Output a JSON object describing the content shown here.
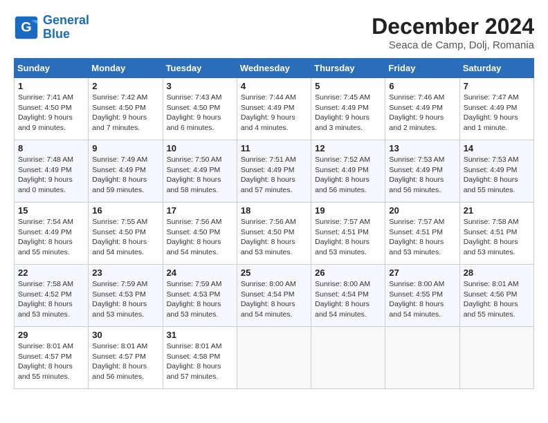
{
  "header": {
    "logo_line1": "General",
    "logo_line2": "Blue",
    "title": "December 2024",
    "subtitle": "Seaca de Camp, Dolj, Romania"
  },
  "weekdays": [
    "Sunday",
    "Monday",
    "Tuesday",
    "Wednesday",
    "Thursday",
    "Friday",
    "Saturday"
  ],
  "weeks": [
    [
      {
        "day": "1",
        "info": "Sunrise: 7:41 AM\nSunset: 4:50 PM\nDaylight: 9 hours\nand 9 minutes."
      },
      {
        "day": "2",
        "info": "Sunrise: 7:42 AM\nSunset: 4:50 PM\nDaylight: 9 hours\nand 7 minutes."
      },
      {
        "day": "3",
        "info": "Sunrise: 7:43 AM\nSunset: 4:50 PM\nDaylight: 9 hours\nand 6 minutes."
      },
      {
        "day": "4",
        "info": "Sunrise: 7:44 AM\nSunset: 4:49 PM\nDaylight: 9 hours\nand 4 minutes."
      },
      {
        "day": "5",
        "info": "Sunrise: 7:45 AM\nSunset: 4:49 PM\nDaylight: 9 hours\nand 3 minutes."
      },
      {
        "day": "6",
        "info": "Sunrise: 7:46 AM\nSunset: 4:49 PM\nDaylight: 9 hours\nand 2 minutes."
      },
      {
        "day": "7",
        "info": "Sunrise: 7:47 AM\nSunset: 4:49 PM\nDaylight: 9 hours\nand 1 minute."
      }
    ],
    [
      {
        "day": "8",
        "info": "Sunrise: 7:48 AM\nSunset: 4:49 PM\nDaylight: 9 hours\nand 0 minutes."
      },
      {
        "day": "9",
        "info": "Sunrise: 7:49 AM\nSunset: 4:49 PM\nDaylight: 8 hours\nand 59 minutes."
      },
      {
        "day": "10",
        "info": "Sunrise: 7:50 AM\nSunset: 4:49 PM\nDaylight: 8 hours\nand 58 minutes."
      },
      {
        "day": "11",
        "info": "Sunrise: 7:51 AM\nSunset: 4:49 PM\nDaylight: 8 hours\nand 57 minutes."
      },
      {
        "day": "12",
        "info": "Sunrise: 7:52 AM\nSunset: 4:49 PM\nDaylight: 8 hours\nand 56 minutes."
      },
      {
        "day": "13",
        "info": "Sunrise: 7:53 AM\nSunset: 4:49 PM\nDaylight: 8 hours\nand 56 minutes."
      },
      {
        "day": "14",
        "info": "Sunrise: 7:53 AM\nSunset: 4:49 PM\nDaylight: 8 hours\nand 55 minutes."
      }
    ],
    [
      {
        "day": "15",
        "info": "Sunrise: 7:54 AM\nSunset: 4:49 PM\nDaylight: 8 hours\nand 55 minutes."
      },
      {
        "day": "16",
        "info": "Sunrise: 7:55 AM\nSunset: 4:50 PM\nDaylight: 8 hours\nand 54 minutes."
      },
      {
        "day": "17",
        "info": "Sunrise: 7:56 AM\nSunset: 4:50 PM\nDaylight: 8 hours\nand 54 minutes."
      },
      {
        "day": "18",
        "info": "Sunrise: 7:56 AM\nSunset: 4:50 PM\nDaylight: 8 hours\nand 53 minutes."
      },
      {
        "day": "19",
        "info": "Sunrise: 7:57 AM\nSunset: 4:51 PM\nDaylight: 8 hours\nand 53 minutes."
      },
      {
        "day": "20",
        "info": "Sunrise: 7:57 AM\nSunset: 4:51 PM\nDaylight: 8 hours\nand 53 minutes."
      },
      {
        "day": "21",
        "info": "Sunrise: 7:58 AM\nSunset: 4:51 PM\nDaylight: 8 hours\nand 53 minutes."
      }
    ],
    [
      {
        "day": "22",
        "info": "Sunrise: 7:58 AM\nSunset: 4:52 PM\nDaylight: 8 hours\nand 53 minutes."
      },
      {
        "day": "23",
        "info": "Sunrise: 7:59 AM\nSunset: 4:53 PM\nDaylight: 8 hours\nand 53 minutes."
      },
      {
        "day": "24",
        "info": "Sunrise: 7:59 AM\nSunset: 4:53 PM\nDaylight: 8 hours\nand 53 minutes."
      },
      {
        "day": "25",
        "info": "Sunrise: 8:00 AM\nSunset: 4:54 PM\nDaylight: 8 hours\nand 54 minutes."
      },
      {
        "day": "26",
        "info": "Sunrise: 8:00 AM\nSunset: 4:54 PM\nDaylight: 8 hours\nand 54 minutes."
      },
      {
        "day": "27",
        "info": "Sunrise: 8:00 AM\nSunset: 4:55 PM\nDaylight: 8 hours\nand 54 minutes."
      },
      {
        "day": "28",
        "info": "Sunrise: 8:01 AM\nSunset: 4:56 PM\nDaylight: 8 hours\nand 55 minutes."
      }
    ],
    [
      {
        "day": "29",
        "info": "Sunrise: 8:01 AM\nSunset: 4:57 PM\nDaylight: 8 hours\nand 55 minutes."
      },
      {
        "day": "30",
        "info": "Sunrise: 8:01 AM\nSunset: 4:57 PM\nDaylight: 8 hours\nand 56 minutes."
      },
      {
        "day": "31",
        "info": "Sunrise: 8:01 AM\nSunset: 4:58 PM\nDaylight: 8 hours\nand 57 minutes."
      },
      {
        "day": "",
        "info": ""
      },
      {
        "day": "",
        "info": ""
      },
      {
        "day": "",
        "info": ""
      },
      {
        "day": "",
        "info": ""
      }
    ]
  ]
}
